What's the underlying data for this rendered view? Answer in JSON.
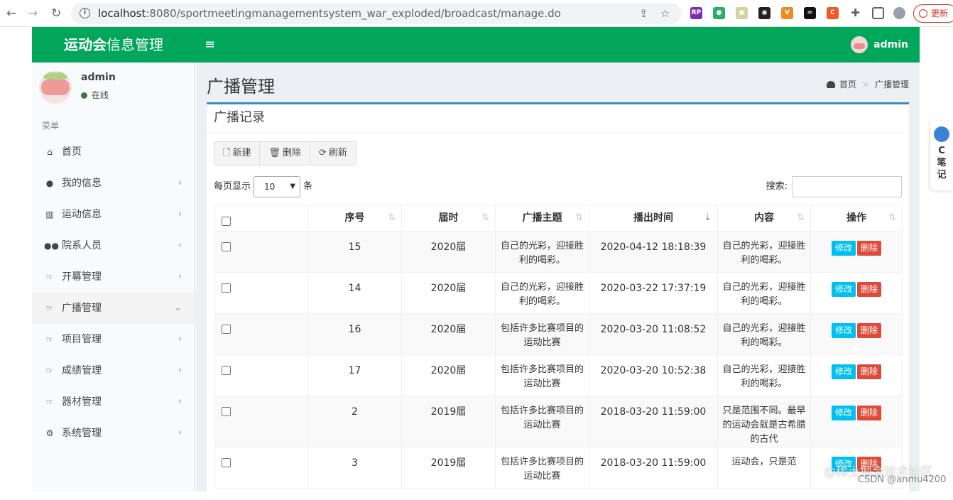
{
  "browser": {
    "url_host": "localhost",
    "url_rest": ":8080/sportmeetingmanagementsystem_war_exploded/broadcast/manage.do",
    "update_label": "更新"
  },
  "header": {
    "logo_bold": "运动会",
    "logo_rest": "信息管理",
    "user": "admin"
  },
  "sidebar": {
    "user_name": "admin",
    "user_status": "在线",
    "menu_header": "菜单",
    "items": [
      {
        "label": "首页",
        "icon": "home-icon"
      },
      {
        "label": "我的信息",
        "icon": "user-icon"
      },
      {
        "label": "运动信息",
        "icon": "bar-chart-icon"
      },
      {
        "label": "院系人员",
        "icon": "users-icon"
      },
      {
        "label": "开幕管理",
        "icon": "hand-pointer-icon"
      },
      {
        "label": "广播管理",
        "icon": "hand-pointer-icon"
      },
      {
        "label": "项目管理",
        "icon": "hand-pointer-icon"
      },
      {
        "label": "成绩管理",
        "icon": "hand-pointer-icon"
      },
      {
        "label": "器材管理",
        "icon": "hand-pointer-icon"
      },
      {
        "label": "系统管理",
        "icon": "gear-icon"
      }
    ]
  },
  "page": {
    "title": "广播管理",
    "breadcrumb_home": "首页",
    "breadcrumb_current": "广播管理"
  },
  "box": {
    "title": "广播记录",
    "buttons": {
      "new": "新建",
      "delete": "删除",
      "refresh": "刷新"
    },
    "length_prefix": "每页显示",
    "length_value": "10",
    "length_suffix": "条",
    "search_label": "搜索:"
  },
  "table": {
    "headers": [
      "序号",
      "届时",
      "广播主题",
      "播出时间",
      "内容",
      "操作"
    ],
    "edit_label": "修改",
    "delete_label": "删除",
    "rows": [
      {
        "id": "15",
        "session": "2020届",
        "theme": "自己的光彩，迎接胜利的喝彩。",
        "time": "2020-04-12 18:18:39",
        "content": "自己的光彩，迎接胜利的喝彩。"
      },
      {
        "id": "14",
        "session": "2020届",
        "theme": "自己的光彩，迎接胜利的喝彩。",
        "time": "2020-03-22 17:37:19",
        "content": "自己的光彩，迎接胜利的喝彩。"
      },
      {
        "id": "16",
        "session": "2020届",
        "theme": "包括许多比赛项目的运动比赛",
        "time": "2020-03-20 11:08:52",
        "content": "自己的光彩，迎接胜利的喝彩。"
      },
      {
        "id": "17",
        "session": "2020届",
        "theme": "包括许多比赛项目的运动比赛",
        "time": "2020-03-20 10:52:38",
        "content": "自己的光彩，迎接胜利的喝彩。"
      },
      {
        "id": "2",
        "session": "2019届",
        "theme": "包括许多比赛项目的运动比赛",
        "time": "2018-03-20 11:59:00",
        "content": "只是范围不同。最早的运动会就是古希腊的古代"
      },
      {
        "id": "3",
        "session": "2019届",
        "theme": "包括许多比赛项目的运动比赛",
        "time": "2018-03-20 11:59:00",
        "content": "运动会，只是范"
      }
    ]
  },
  "side_widget": {
    "lines": [
      "C",
      "笔",
      "记"
    ]
  },
  "watermark": {
    "line1": "@稀土掘金技术社区",
    "line2": "CSDN @anmu4200"
  }
}
